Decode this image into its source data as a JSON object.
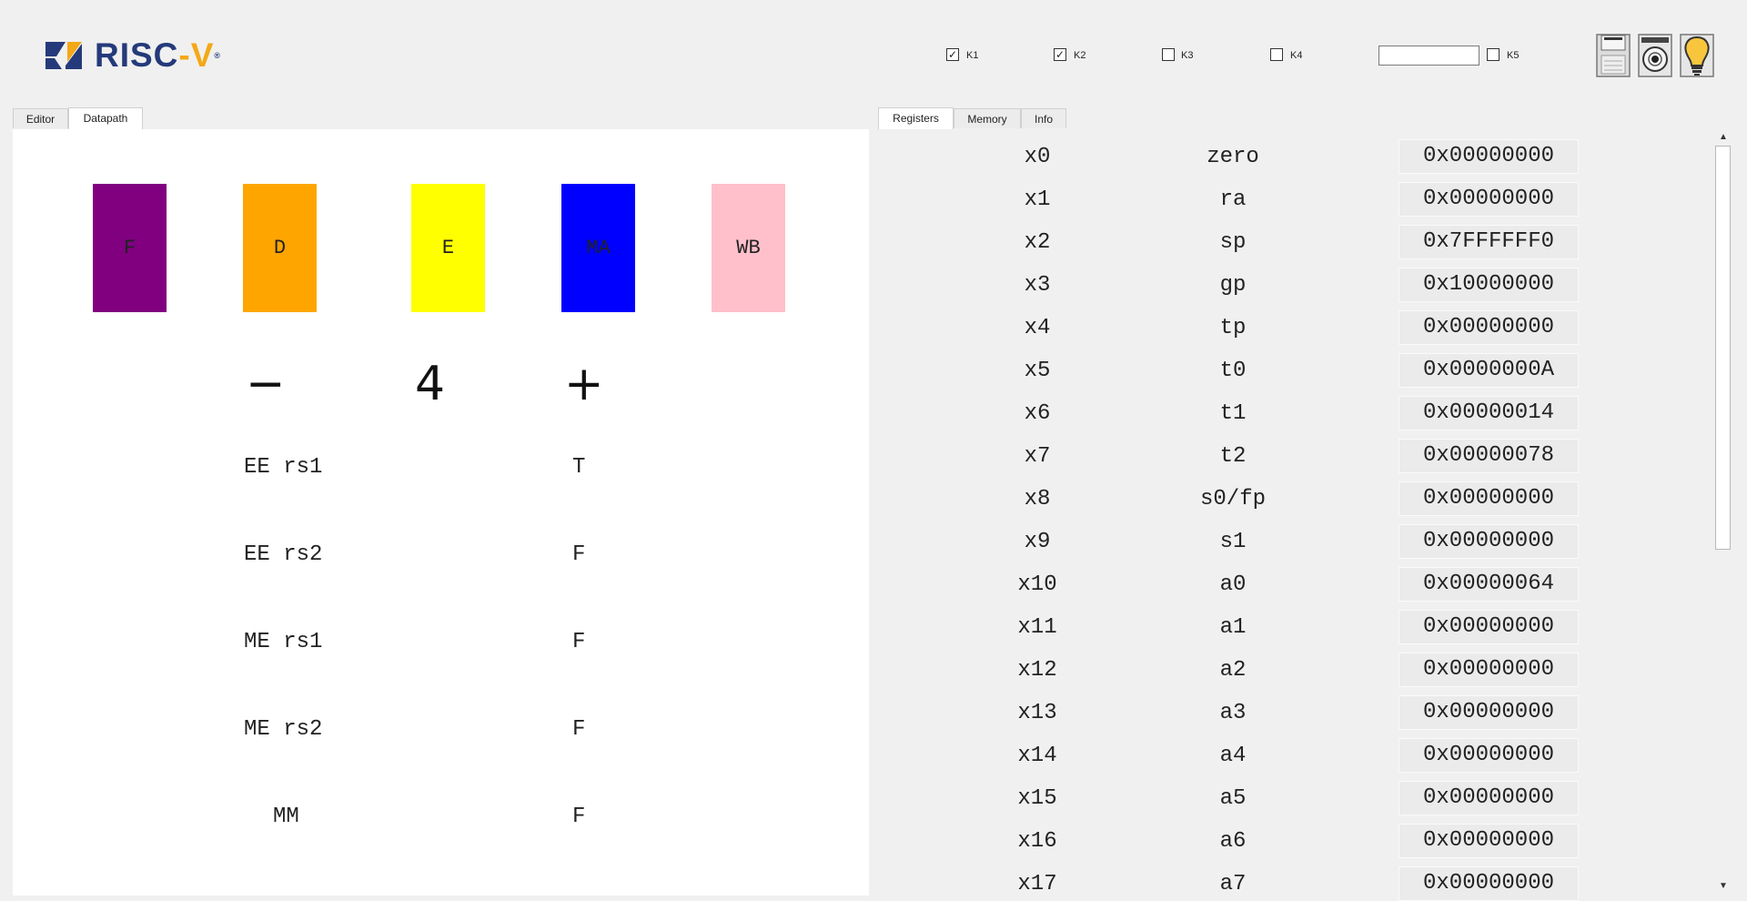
{
  "logo": {
    "brand": "RISC",
    "dash": "-",
    "tail": "V",
    "reg": "®"
  },
  "toolbar": {
    "checkboxes": [
      {
        "label": "K1",
        "checked": true
      },
      {
        "label": "K2",
        "checked": true
      },
      {
        "label": "K3",
        "checked": false
      },
      {
        "label": "K4",
        "checked": false
      },
      {
        "label": "K5",
        "checked": false
      }
    ],
    "k5_input_value": "",
    "icons": [
      "save-icon",
      "camera-icon",
      "lightbulb-icon"
    ]
  },
  "left_tabs": [
    {
      "label": "Editor",
      "active": false
    },
    {
      "label": "Datapath",
      "active": true
    }
  ],
  "right_tabs": [
    {
      "label": "Registers",
      "active": true
    },
    {
      "label": "Memory",
      "active": false
    },
    {
      "label": "Info",
      "active": false
    }
  ],
  "datapath": {
    "stages": [
      {
        "label": "F",
        "color": "#800080"
      },
      {
        "label": "D",
        "color": "#FFA500"
      },
      {
        "label": "E",
        "color": "#FFFF00"
      },
      {
        "label": "MA",
        "color": "#0000FF"
      },
      {
        "label": "WB",
        "color": "#FFC0CB"
      }
    ],
    "speed": {
      "minus": "−",
      "value": "4",
      "plus": "+"
    },
    "hazards": [
      {
        "label": "EE rs1",
        "value": "T"
      },
      {
        "label": "EE rs2",
        "value": "F"
      },
      {
        "label": "ME rs1",
        "value": "F"
      },
      {
        "label": "ME rs2",
        "value": "F"
      },
      {
        "label": "MM",
        "value": "F"
      }
    ]
  },
  "registers": [
    {
      "reg": "x0",
      "abi": "zero",
      "value": "0x00000000"
    },
    {
      "reg": "x1",
      "abi": "ra",
      "value": "0x00000000"
    },
    {
      "reg": "x2",
      "abi": "sp",
      "value": "0x7FFFFFF0"
    },
    {
      "reg": "x3",
      "abi": "gp",
      "value": "0x10000000"
    },
    {
      "reg": "x4",
      "abi": "tp",
      "value": "0x00000000"
    },
    {
      "reg": "x5",
      "abi": "t0",
      "value": "0x0000000A"
    },
    {
      "reg": "x6",
      "abi": "t1",
      "value": "0x00000014"
    },
    {
      "reg": "x7",
      "abi": "t2",
      "value": "0x00000078"
    },
    {
      "reg": "x8",
      "abi": "s0/fp",
      "value": "0x00000000"
    },
    {
      "reg": "x9",
      "abi": "s1",
      "value": "0x00000000"
    },
    {
      "reg": "x10",
      "abi": "a0",
      "value": "0x00000064"
    },
    {
      "reg": "x11",
      "abi": "a1",
      "value": "0x00000000"
    },
    {
      "reg": "x12",
      "abi": "a2",
      "value": "0x00000000"
    },
    {
      "reg": "x13",
      "abi": "a3",
      "value": "0x00000000"
    },
    {
      "reg": "x14",
      "abi": "a4",
      "value": "0x00000000"
    },
    {
      "reg": "x15",
      "abi": "a5",
      "value": "0x00000000"
    },
    {
      "reg": "x16",
      "abi": "a6",
      "value": "0x00000000"
    },
    {
      "reg": "x17",
      "abi": "a7",
      "value": "0x00000000"
    }
  ],
  "scrollbar": {
    "up": "▲",
    "down": "▼"
  }
}
